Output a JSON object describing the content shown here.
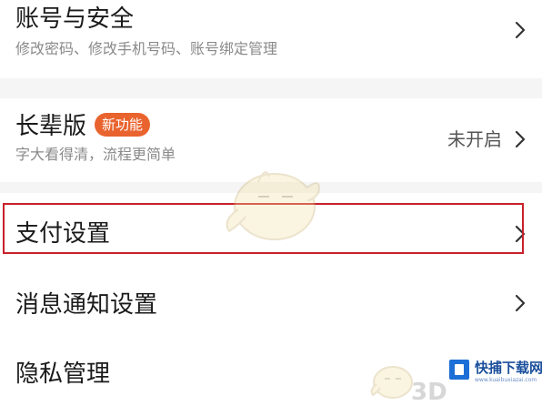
{
  "settings": {
    "items": [
      {
        "title": "账号与安全",
        "subtitle": "修改密码、修改手机号码、账号绑定管理"
      },
      {
        "title": "长辈版",
        "badge": "新功能",
        "subtitle": "字大看得清，流程更简单",
        "status": "未开启"
      },
      {
        "title": "支付设置",
        "highlighted": true
      },
      {
        "title": "消息通知设置"
      },
      {
        "title": "隐私管理"
      }
    ]
  },
  "watermark": {
    "brand": "快捕下载网",
    "url": "www.kuaibuxiazai.com",
    "mark_3d": "3D"
  },
  "colors": {
    "background": "#f5f5f5",
    "row_background": "#ffffff",
    "badge": "#e9632e",
    "highlight_border": "#c8202a"
  },
  "icons": {
    "row_arrow": "chevron-right-icon"
  }
}
